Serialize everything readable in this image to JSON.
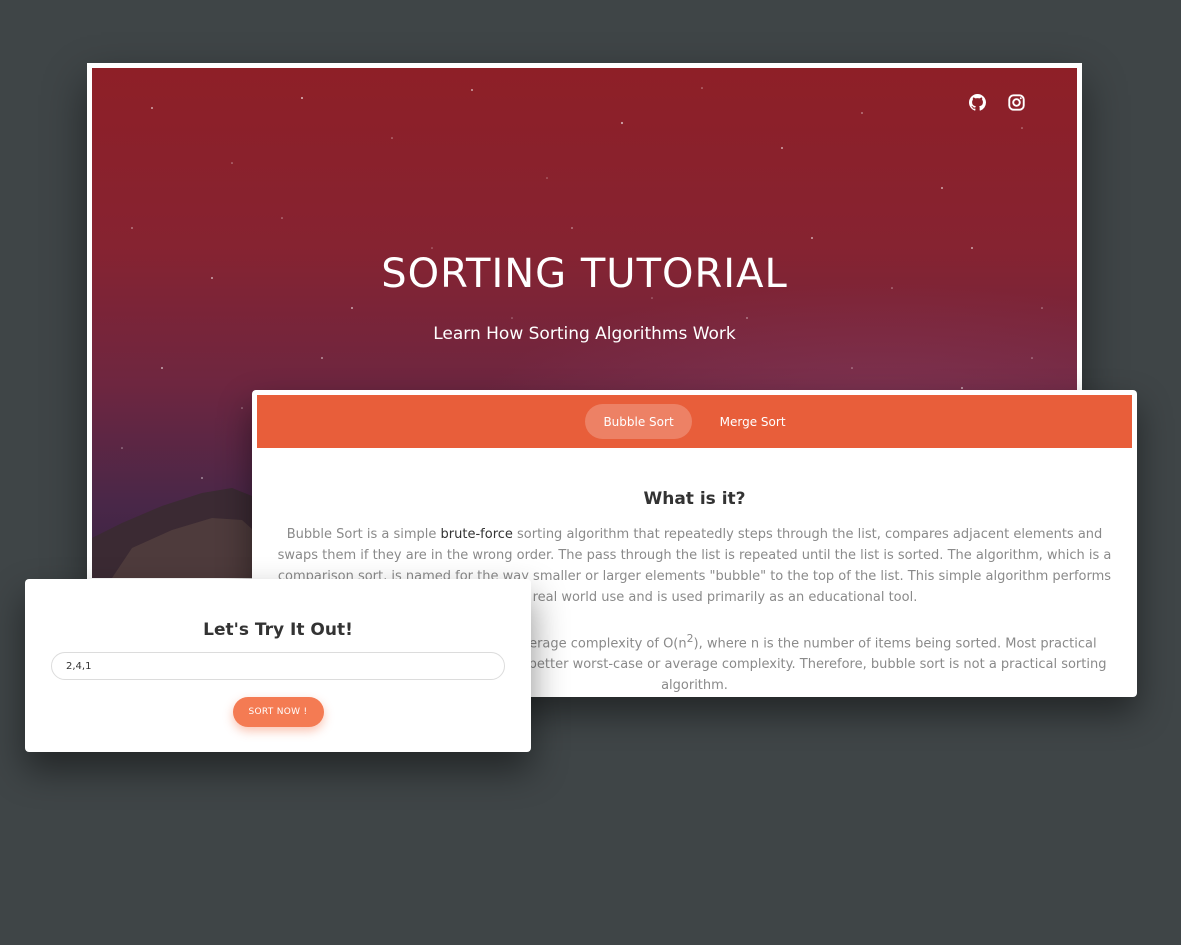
{
  "hero": {
    "title": "SORTING TUTORIAL",
    "subtitle": "Learn How Sorting Algorithms Work",
    "social_icons": [
      "github-icon",
      "instagram-icon"
    ]
  },
  "tutorial": {
    "tabs": [
      {
        "label": "Bubble Sort",
        "active": true
      },
      {
        "label": "Merge Sort",
        "active": false
      }
    ],
    "heading": "What is it?",
    "p1_start": "Bubble Sort is a simple ",
    "p1_highlight": "brute-force",
    "p1_end": " sorting algorithm that repeatedly steps through the list, compares adjacent elements and swaps them if they are in the wrong order. The pass through the list is repeated until the list is sorted. The algorithm, which is a comparison sort, is named for the way smaller or larger elements \"bubble\" to the top of the list. This simple algorithm performs poorly in real world use and is used primarily as an educational tool.",
    "p2_start": "Bubble sort has a worst-case and average complexity of O(n",
    "p2_sup": "2",
    "p2_end": "), where n is the number of items being sorted. Most practical sorting algorithms have substantially better worst-case or average complexity. Therefore, bubble sort is not a practical sorting algorithm."
  },
  "try_it": {
    "heading": "Let's Try It Out!",
    "input_value": "2,4,1",
    "button_label": "SORT NOW !"
  },
  "colors": {
    "page_background": "#3f4547",
    "accent": "#e85e3a",
    "button": "#f47b53",
    "hero_top": "#8e1f27"
  }
}
